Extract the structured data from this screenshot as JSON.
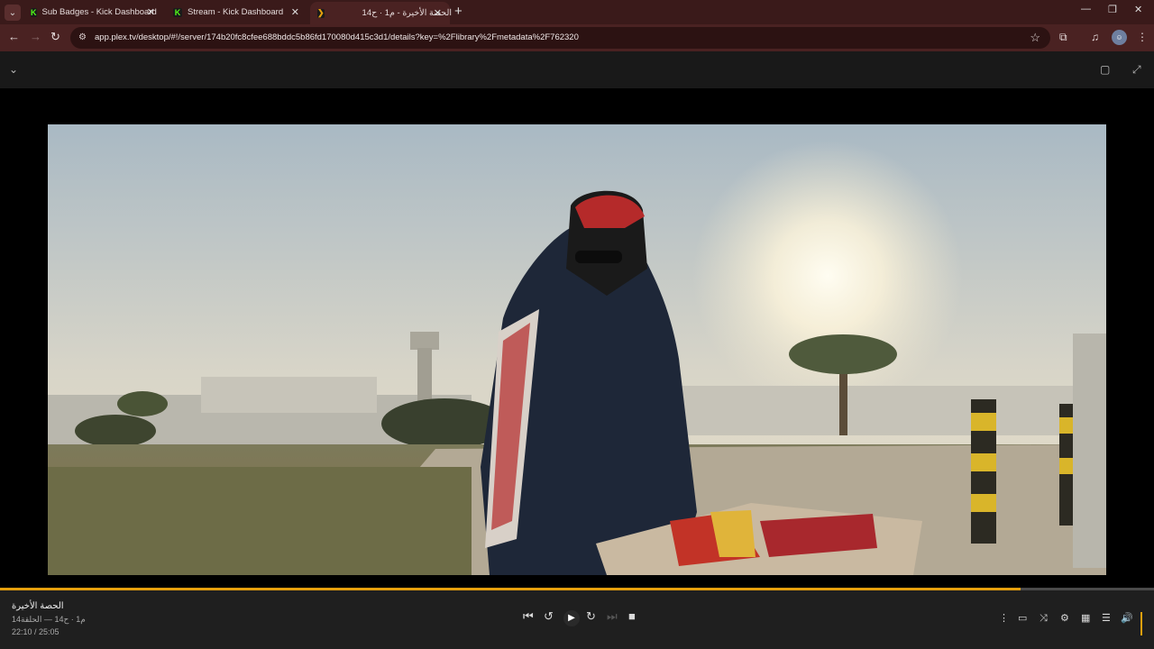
{
  "browser": {
    "tabs": [
      {
        "label": "Sub Badges - Kick Dashboard",
        "close": "✕"
      },
      {
        "label": "Stream - Kick Dashboard",
        "close": "✕"
      },
      {
        "label": "الحصة الأخيرة - م1 · ح14",
        "close": "✕"
      }
    ],
    "kick_glyph": "K",
    "plex_glyph": "❯",
    "new_tab": "+",
    "tab_list": "⌄",
    "url": "app.plex.tv/desktop/#!/server/174b20fc8cfee688bddc5b86fd170080d415c3d1/details?key=%2Flibrary%2Fmetadata%2F762320",
    "window_controls": {
      "minimize": "—",
      "restore": "❐",
      "close": "✕"
    }
  },
  "player": {
    "title": "الحصة الأخيرة",
    "subtitle": "م1 · ح14 — الحلقة14",
    "time": "22:10 / 25:05",
    "progress": 0.884
  },
  "colors": {
    "accent": "#e5a00d",
    "kick": "#53fc18",
    "chrome_bg": "#3a1a1a"
  }
}
